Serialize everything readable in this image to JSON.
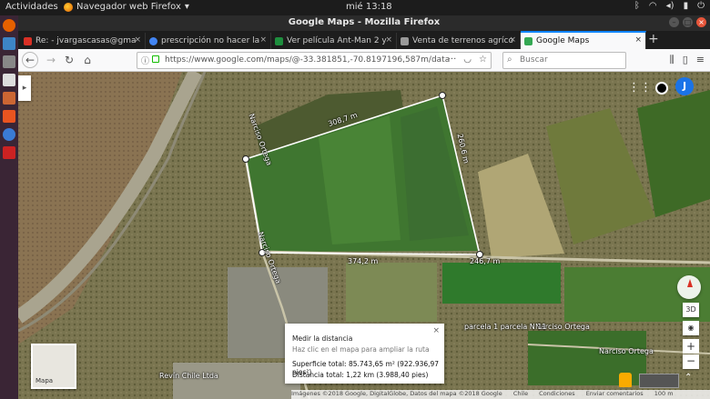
{
  "topbar": {
    "activities": "Actividades",
    "app_name": "Navegador web Firefox",
    "clock": "mié 13:18"
  },
  "window": {
    "title": "Google Maps - Mozilla Firefox"
  },
  "tabs": [
    {
      "label": "Re: - jvargascasas@gma",
      "fav_color": "#d93025"
    },
    {
      "label": "prescripción no hacer la",
      "fav_color": "#4285f4"
    },
    {
      "label": "Ver película Ant-Man 2 y",
      "fav_color": "#1e8e3e"
    },
    {
      "label": "Venta de terrenos agríco",
      "fav_color": "#999999"
    },
    {
      "label": "Google Maps",
      "fav_color": "#34a853"
    }
  ],
  "nav": {
    "url": "https://www.google.com/maps/@-33.381851,-70.8197196,587m/data",
    "search_placeholder": "Buscar"
  },
  "account": {
    "initial": "J"
  },
  "map": {
    "labels": {
      "road_top": "Narciso Ortega",
      "road_left": "Narciso Ortega",
      "road_bottom1": "Narciso Ortega",
      "road_bottom2": "Narciso Ortega",
      "parcel": "parcela 1 parcela N 11",
      "place": "Revín Chile Ltda",
      "seg1": "308,7 m",
      "seg2": "260,6 m",
      "seg3": "374,2 m",
      "seg4": "246,7 m"
    },
    "minimap_label": "Mapa"
  },
  "measure": {
    "title": "Medir la distancia",
    "hint": "Haz clic en el mapa para ampliar la ruta",
    "area": "Superficie total: 85.743,65 m² (922.936,97 pies²)",
    "distance": "Distancia total: 1,22 km (3.988,40 pies)"
  },
  "controls": {
    "btn3d": "3D"
  },
  "footer": {
    "attribution": "Imágenes ©2018 Google, DigitalGlobe, Datos del mapa ©2018 Google",
    "country": "Chile",
    "terms": "Condiciones",
    "feedback": "Enviar comentarios",
    "scale": "100 m"
  },
  "colors": {
    "accent": "#0a84ff",
    "panel_bg": "#1c1c1c",
    "launcher_bg": "#3a2535",
    "avatar_bg": "#1a73e8"
  }
}
